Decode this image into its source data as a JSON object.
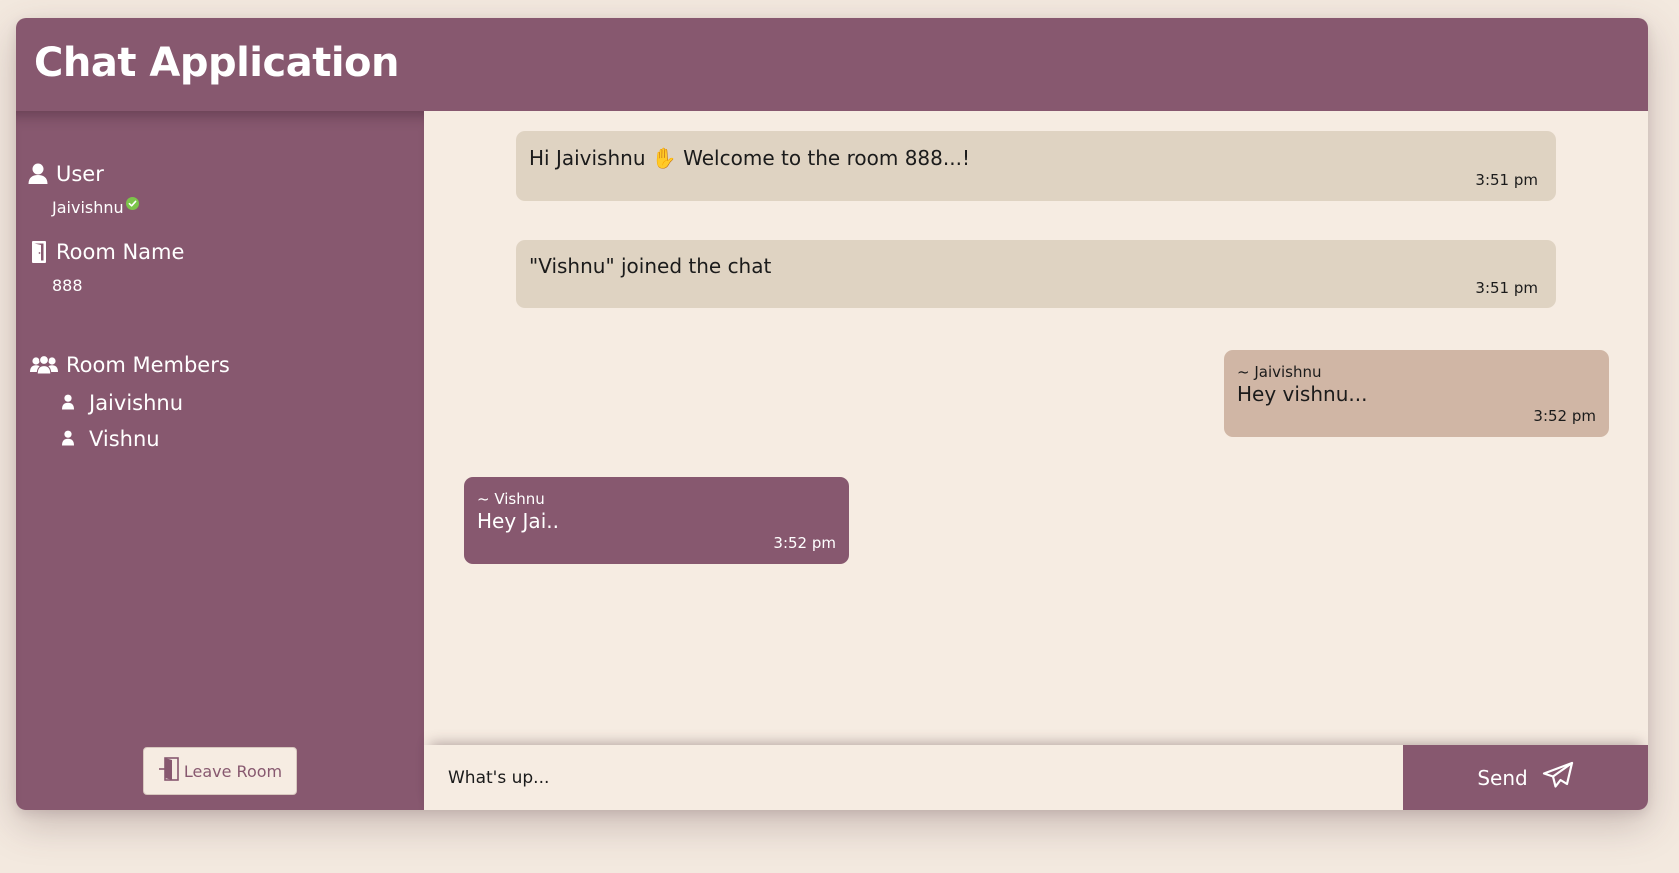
{
  "app": {
    "title": "Chat Application"
  },
  "sidebar": {
    "user_heading": "User",
    "user_name": "Jaivishnu",
    "room_heading": "Room Name",
    "room_name": "888",
    "members_heading": "Room Members",
    "members": [
      "Jaivishnu",
      "Vishnu"
    ],
    "leave_label": "Leave Room"
  },
  "messages": [
    {
      "type": "system",
      "text": "Hi Jaivishnu",
      "emoji": "✋",
      "text_after": "Welcome to the room 888...!",
      "time": "3:51 pm"
    },
    {
      "type": "system",
      "text": "\"Vishnu\" joined the chat",
      "time": "3:51 pm"
    },
    {
      "type": "mine",
      "sender": "~ Jaivishnu",
      "text": "Hey vishnu...",
      "time": "3:52 pm"
    },
    {
      "type": "theirs",
      "sender": "~ Vishnu",
      "text": "Hey Jai..",
      "time": "3:52 pm"
    }
  ],
  "composer": {
    "placeholder": "What's up...",
    "send_label": "Send"
  },
  "colors": {
    "primary": "#87586f",
    "background": "#f6ece2",
    "system_bubble": "#dfd3c2",
    "own_bubble": "#d0b6a5",
    "online": "#7cc44a"
  },
  "icons": {
    "user": "user-icon",
    "room": "door-icon",
    "members": "users-icon",
    "member": "user-small-icon",
    "online": "check-circle-icon",
    "leave": "exit-door-icon",
    "send": "paper-plane-icon"
  }
}
